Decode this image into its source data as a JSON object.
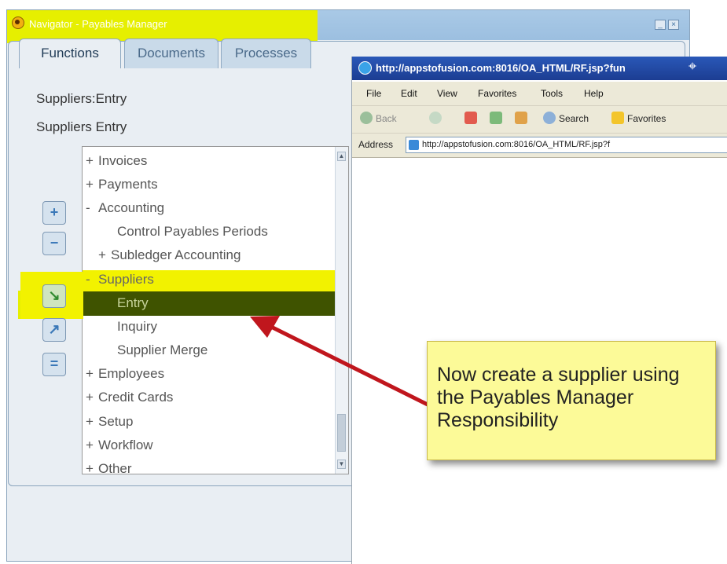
{
  "navigator": {
    "title": "Navigator - Payables Manager",
    "minimize_glyph": "_",
    "close_glyph": "×",
    "tabs": [
      {
        "label": "Functions"
      },
      {
        "label": "Documents"
      },
      {
        "label": "Processes"
      }
    ],
    "selected_path": "Suppliers:Entry",
    "selected_name": "Suppliers Entry",
    "tree": [
      {
        "sign": "+",
        "label": "Invoices"
      },
      {
        "sign": "+",
        "label": "Payments"
      },
      {
        "sign": "-",
        "label": "Accounting"
      },
      {
        "sign": "",
        "label": "Control Payables Periods"
      },
      {
        "sign": "+",
        "label": "Subledger Accounting"
      },
      {
        "sign": "-",
        "label": "Suppliers"
      },
      {
        "sign": "",
        "label": "Entry"
      },
      {
        "sign": "",
        "label": "Inquiry"
      },
      {
        "sign": "",
        "label": "Supplier Merge"
      },
      {
        "sign": "+",
        "label": "Employees"
      },
      {
        "sign": "+",
        "label": "Credit Cards"
      },
      {
        "sign": "+",
        "label": "Setup"
      },
      {
        "sign": "+",
        "label": "Workflow"
      },
      {
        "sign": "+",
        "label": "Other"
      }
    ],
    "side_buttons": {
      "expand": "+",
      "collapse": "−",
      "expand_branch": "↘",
      "expand_all": "↗",
      "collapse_all": "="
    }
  },
  "browser": {
    "title": "http://appstofusion.com:8016/OA_HTML/RF.jsp?fun",
    "menu": [
      "File",
      "Edit",
      "View",
      "Favorites",
      "Tools",
      "Help"
    ],
    "toolbar": {
      "back": "Back",
      "search": "Search",
      "favorites": "Favorites"
    },
    "address_label": "Address",
    "address_url": "http://appstofusion.com:8016/OA_HTML/RF.jsp?f"
  },
  "callout": {
    "text": "Now create a supplier using the Payables Manager Responsibility"
  },
  "colors": {
    "highlight_yellow": "#e6ef00",
    "selected_row": "#3f5300",
    "arrow_red": "#c0161d",
    "callout_bg": "#fcfa98"
  }
}
